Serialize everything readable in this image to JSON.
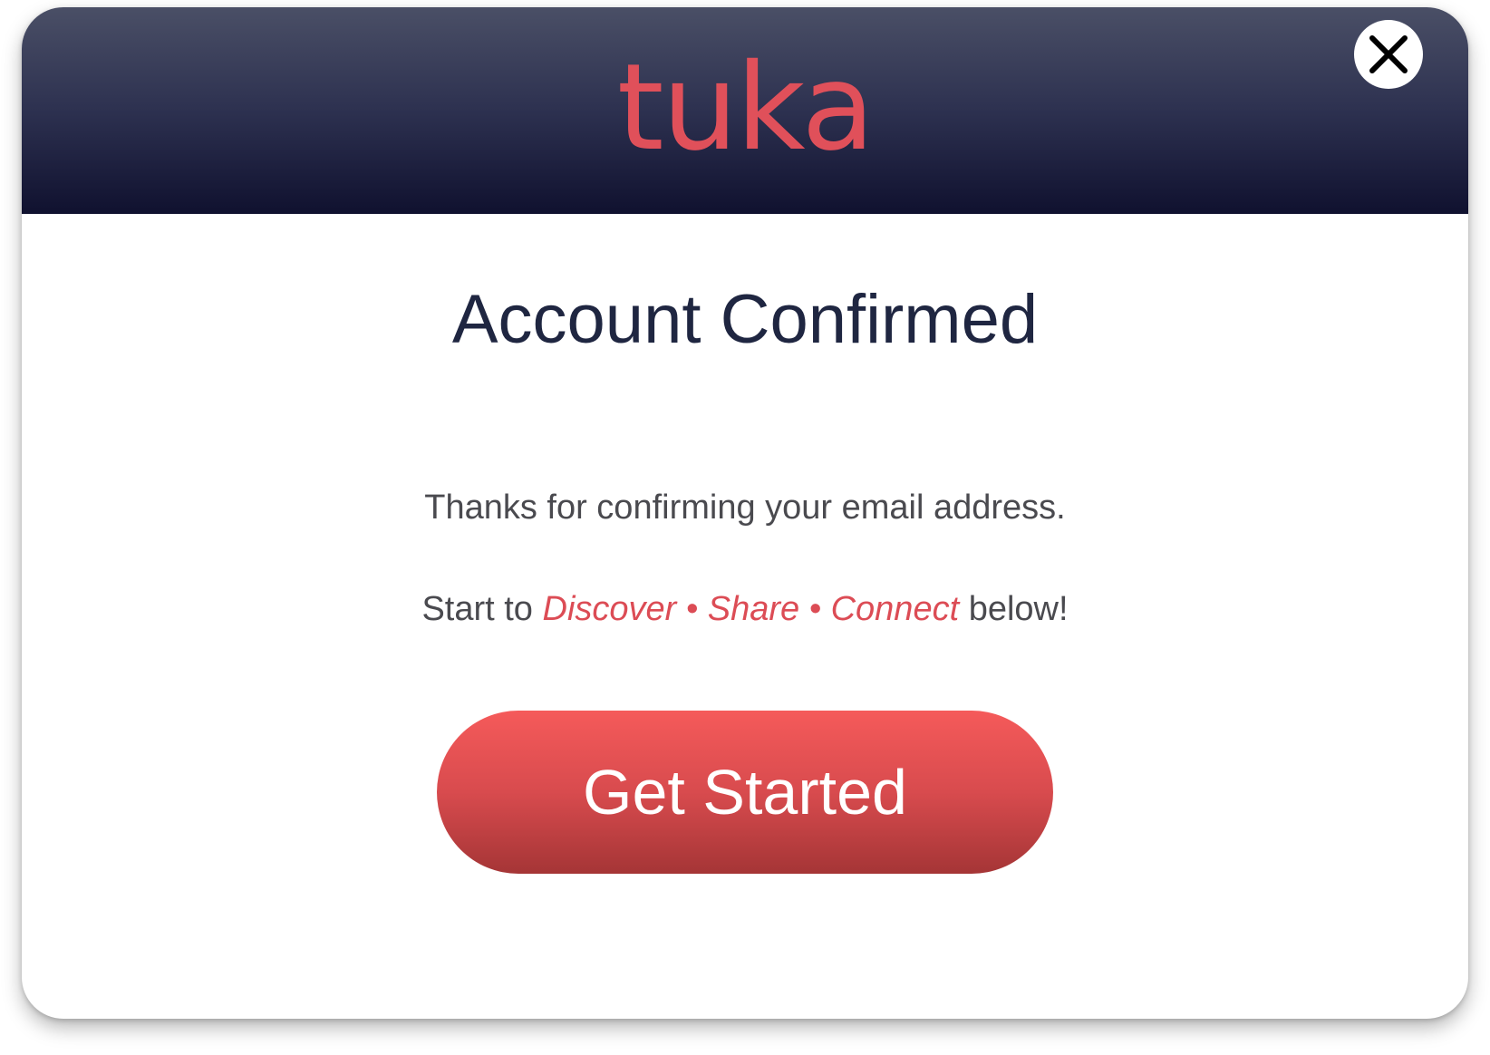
{
  "brand": {
    "logo_text": "tuka",
    "accent_color": "#e0505a",
    "header_color": "#1c1f3f"
  },
  "dialog": {
    "close_icon": "close-icon",
    "title": "Account Confirmed",
    "message": "Thanks for confirming your email address.",
    "tagline": {
      "prefix": "Start to ",
      "discover": "Discover",
      "separator": "•",
      "share": "Share",
      "connect": "Connect",
      "suffix": " below!"
    },
    "cta_label": "Get Started"
  }
}
